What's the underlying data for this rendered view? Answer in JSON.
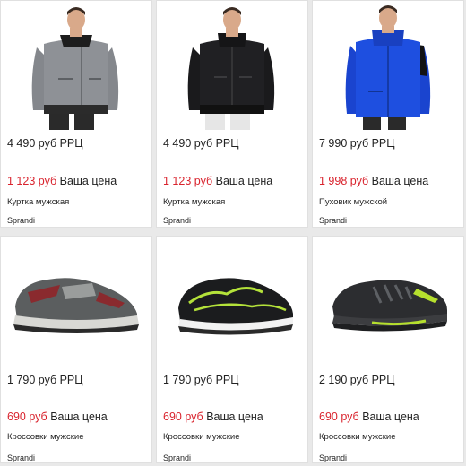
{
  "products": [
    {
      "rrp": "4 490 руб РРЦ",
      "price": "1 123 руб",
      "price_label": "Ваша цена",
      "name": "Куртка мужская",
      "brand": "Sprandi",
      "image": "grey-jacket-photo",
      "color": "#8d8f93"
    },
    {
      "rrp": "4 490 руб РРЦ",
      "price": "1 123 руб",
      "price_label": "Ваша цена",
      "name": "Куртка мужская",
      "brand": "Sprandi",
      "image": "black-jacket-photo",
      "color": "#1c1c1e"
    },
    {
      "rrp": "7 990 руб РРЦ",
      "price": "1 998 руб",
      "price_label": "Ваша цена",
      "name": "Пуховик мужской",
      "brand": "Sprandi",
      "image": "blue-down-jacket-photo",
      "color": "#1948d6"
    },
    {
      "rrp": "1 790 руб РРЦ",
      "price": "690 руб",
      "price_label": "Ваша цена",
      "name": "Кроссовки мужские",
      "brand": "Sprandi",
      "image": "grey-red-sneaker-photo",
      "color": "#8b2a2e"
    },
    {
      "rrp": "1 790 руб РРЦ",
      "price": "690 руб",
      "price_label": "Ваша цена",
      "name": "Кроссовки мужские",
      "brand": "Sprandi",
      "image": "black-lime-sneaker-photo",
      "color": "#a6d62a"
    },
    {
      "rrp": "2 190 руб РРЦ",
      "price": "690 руб",
      "price_label": "Ваша цена",
      "name": "Кроссовки мужские",
      "brand": "Sprandi",
      "image": "dark-lime-sneaker-photo",
      "color": "#b6e02e"
    }
  ],
  "colors": {
    "price_red": "#d9232d",
    "text": "#222222",
    "background": "#e9e9e9"
  }
}
